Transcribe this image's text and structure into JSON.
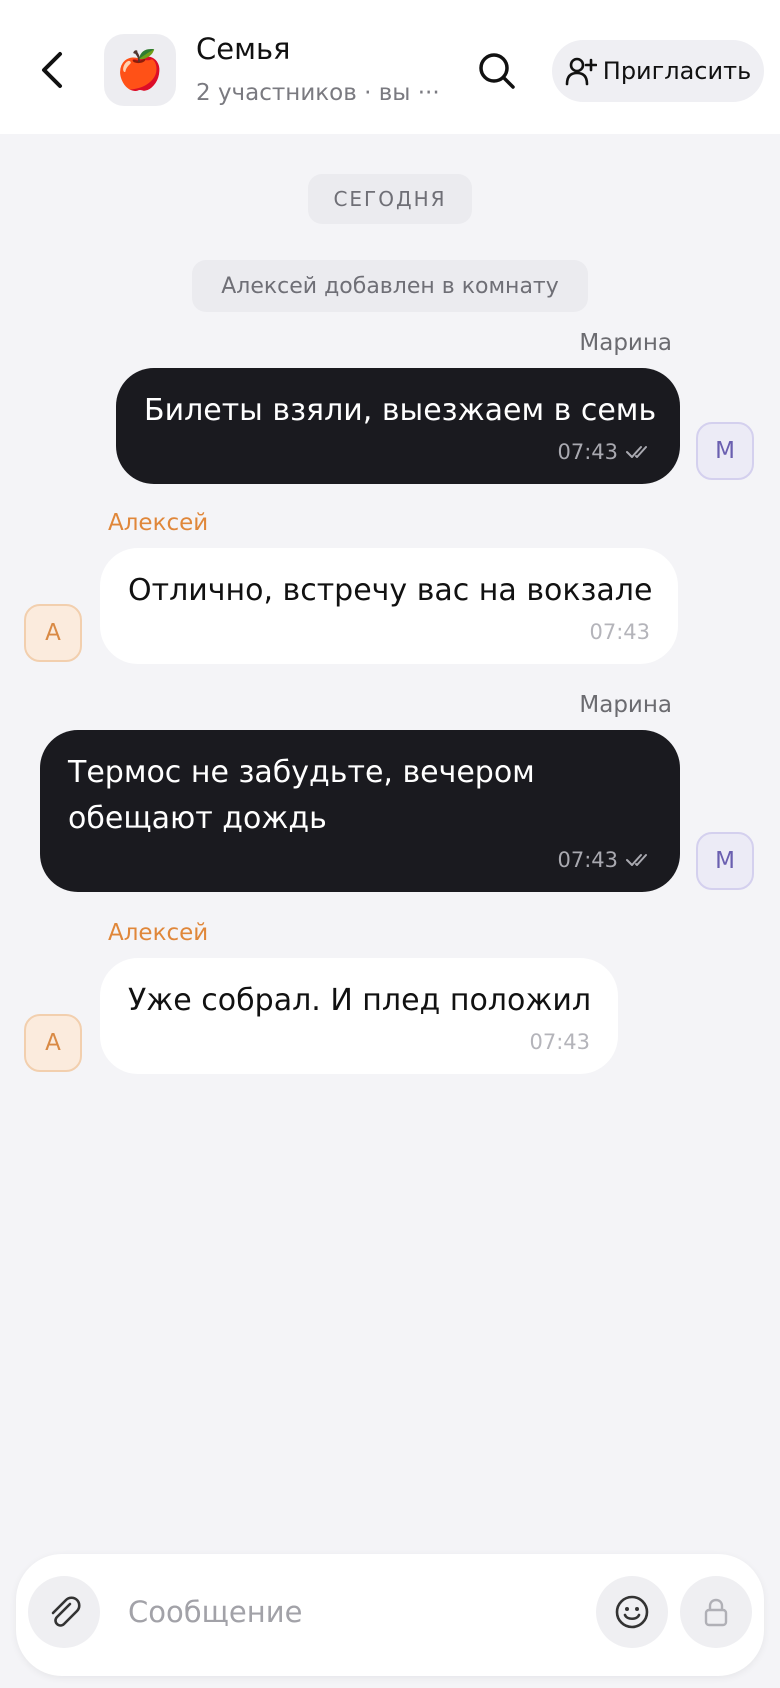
{
  "header": {
    "back_icon": "chevron-left-icon",
    "room_emoji": "🍎",
    "title": "Семья",
    "subtitle": "2 участников · вы ···",
    "search_icon": "search-icon",
    "invite_icon": "add-user-icon",
    "invite_label": "Пригласить"
  },
  "feed": {
    "date_separator": "СЕГОДНЯ",
    "system_message": "Алексей добавлен в комнату",
    "messages": [
      {
        "sender": "Марина",
        "direction": "out",
        "text": [
          "Билеты взяли, выезжаем в семь"
        ],
        "time": "07:43",
        "read": true,
        "avatar": "М"
      },
      {
        "sender": "Алексей",
        "direction": "in",
        "text": [
          "Отлично, встречу вас на вокзале"
        ],
        "time": "07:43",
        "avatar": "А"
      },
      {
        "sender": "Марина",
        "direction": "out",
        "text": [
          "Термос не забудьте, вечером",
          "обещают дождь"
        ],
        "time": "07:43",
        "read": true,
        "avatar": "М"
      },
      {
        "sender": "Алексей",
        "direction": "in",
        "text": [
          "Уже собрал. И плед положил"
        ],
        "time": "07:43",
        "avatar": "А"
      }
    ]
  },
  "composer": {
    "placeholder": "Сообщение",
    "attach_icon": "paperclip-icon",
    "emoji_icon": "smiley-icon",
    "send_icon": "lock-icon"
  },
  "colors": {
    "background": "#f4f4f7",
    "outgoing_bubble": "#1a1a1f",
    "incoming_bubble": "#ffffff",
    "incoming_sender": "#e0873a",
    "avatar_m": "#6a5fb0",
    "avatar_a": "#d98a45"
  }
}
